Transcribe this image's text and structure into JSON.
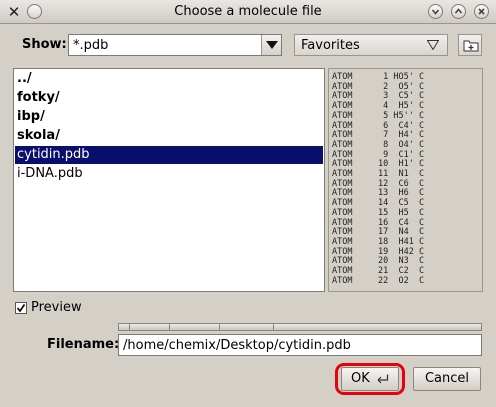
{
  "window": {
    "title": "Choose a molecule file",
    "app_icon": "kde-x-icon"
  },
  "filter": {
    "label": "Show:",
    "value": "*.pdb",
    "favorites_label": "Favorites"
  },
  "files": [
    {
      "name": "../",
      "is_dir": true,
      "selected": false
    },
    {
      "name": "fotky/",
      "is_dir": true,
      "selected": false
    },
    {
      "name": "ibp/",
      "is_dir": true,
      "selected": false
    },
    {
      "name": "skola/",
      "is_dir": true,
      "selected": false
    },
    {
      "name": "cytidin.pdb",
      "is_dir": false,
      "selected": true
    },
    {
      "name": "i-DNA.pdb",
      "is_dir": false,
      "selected": false
    }
  ],
  "preview_lines": [
    "ATOM      1 HO5' C",
    "ATOM      2  O5' C",
    "ATOM      3  C5' C",
    "ATOM      4  H5' C",
    "ATOM      5 H5'' C",
    "ATOM      6  C4' C",
    "ATOM      7  H4' C",
    "ATOM      8  O4' C",
    "ATOM      9  C1' C",
    "ATOM     10  H1' C",
    "ATOM     11  N1  C",
    "ATOM     12  C6  C",
    "ATOM     13  H6  C",
    "ATOM     14  C5  C",
    "ATOM     15  H5  C",
    "ATOM     16  C4  C",
    "ATOM     17  N4  C",
    "ATOM     18  H41 C",
    "ATOM     19  H42 C",
    "ATOM     20  N3  C",
    "ATOM     21  C2  C",
    "ATOM     22  O2  C"
  ],
  "preview": {
    "label": "Preview",
    "checked": true
  },
  "filename": {
    "label": "Filename:",
    "value": "/home/chemix/Desktop/cytidin.pdb"
  },
  "buttons": {
    "ok_label": "OK",
    "cancel_label": "Cancel"
  },
  "colors": {
    "selection": "#0a0f6e",
    "highlight_ring": "#e8000b",
    "dialog_bg": "#d4d0c8"
  }
}
